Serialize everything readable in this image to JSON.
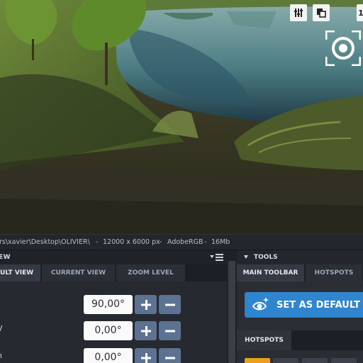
{
  "status_bar": {
    "path": "rs\\xavier\\Desktop\\OLIVIER\\",
    "sep1": "-",
    "dimensions": "12000 x 6000 px",
    "sep2": "-",
    "color_profile": "AdobeRGB",
    "sep3": "-",
    "file_size": "16Mb"
  },
  "left_panel": {
    "title": "EW",
    "tabs": [
      {
        "label": "ULT VIEW",
        "active": true
      },
      {
        "label": "CURRENT VIEW",
        "active": false
      },
      {
        "label": "ZOOM LEVEL",
        "active": false
      }
    ],
    "rows": [
      {
        "label": "/",
        "value": "90,00°"
      },
      {
        "label": "V",
        "value": "0,00°"
      },
      {
        "label": "h",
        "value": "0,00°"
      }
    ]
  },
  "right_panel": {
    "title": "TOOLS",
    "tabs": [
      {
        "label": "MAIN TOOLBAR",
        "active": true
      },
      {
        "label": "HOTSPOTS",
        "active": false
      }
    ],
    "set_default_label": "SET AS DEFAULT VI",
    "hotspots_tab": "HOTSPOTS"
  },
  "toolbar_partial_label": "1",
  "colors": {
    "accent": "#2f86cf",
    "stepper": "#5d7291",
    "chip_active": "#e8a01e"
  },
  "icons": [
    "sliders-icon",
    "copy-icon",
    "target-icon",
    "menu-icon",
    "plus-icon",
    "minus-icon",
    "eye-sparkle-icon"
  ]
}
